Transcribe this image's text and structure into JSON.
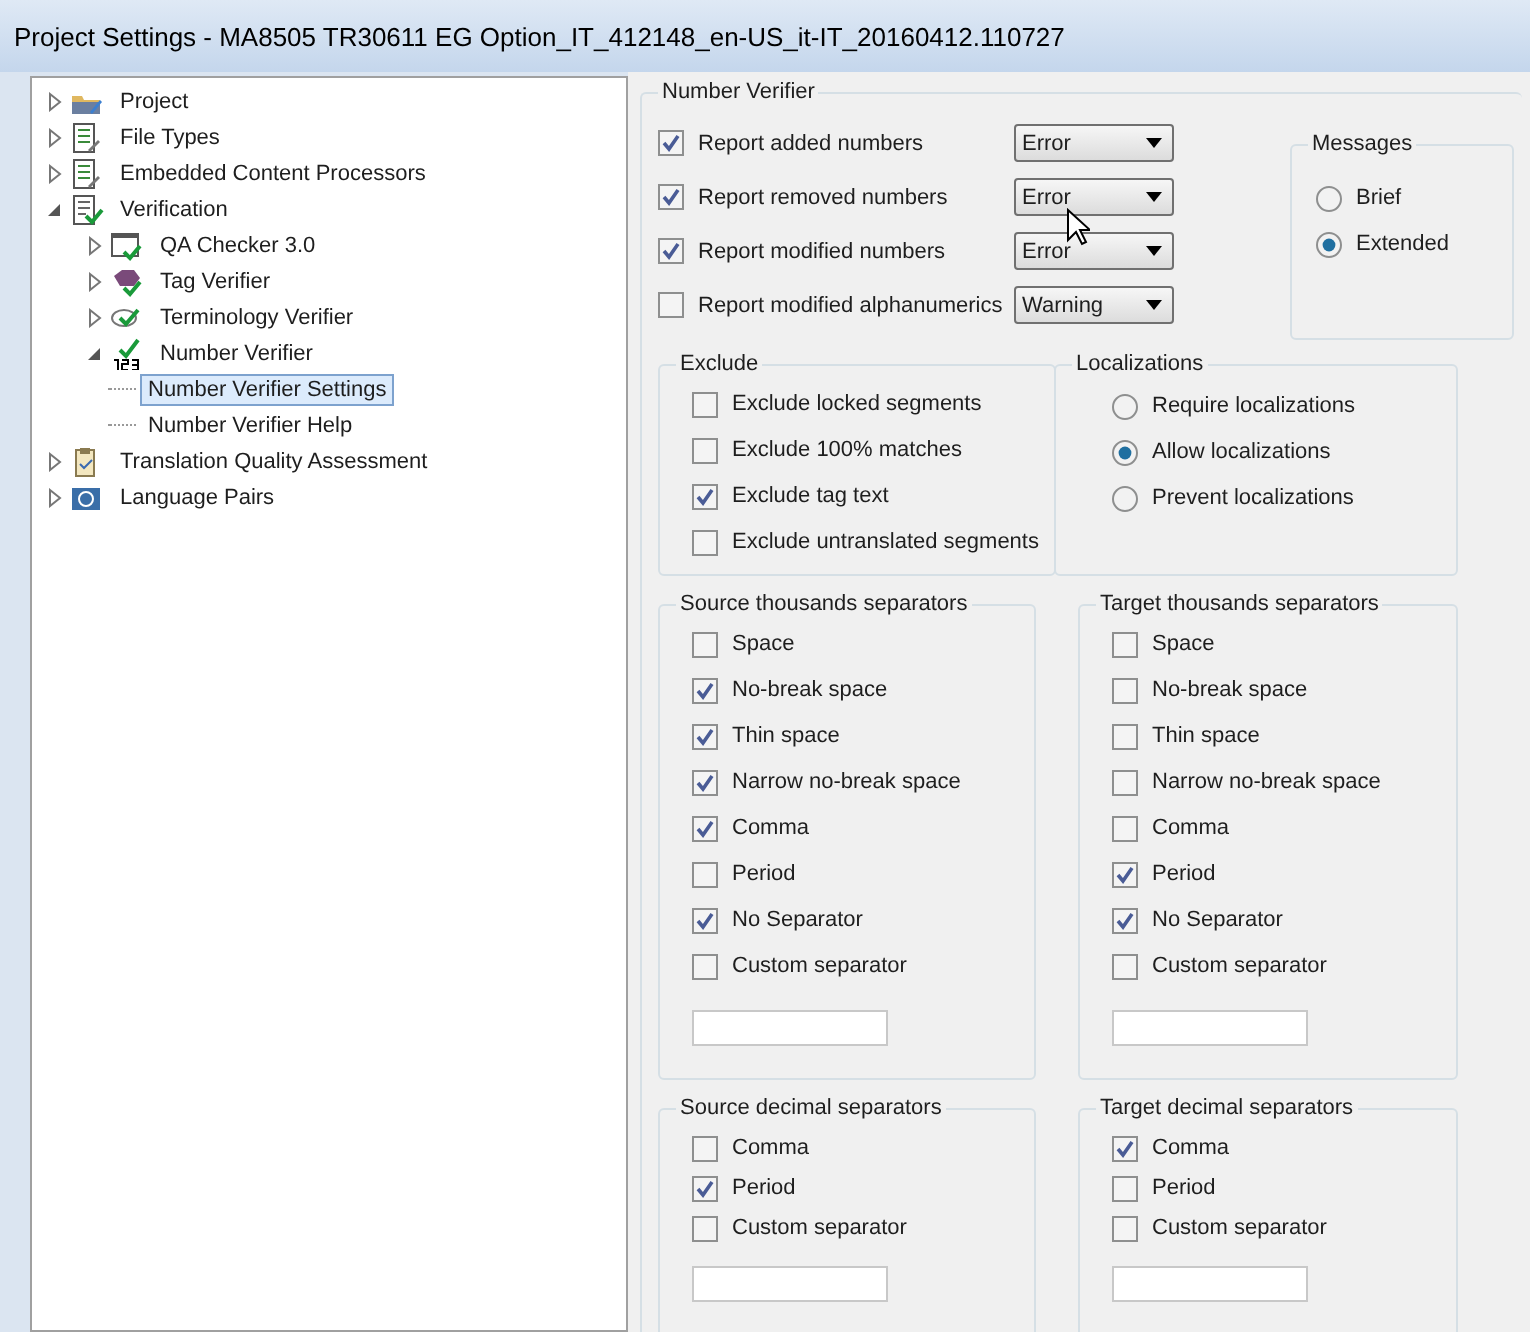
{
  "window": {
    "title": "Project Settings - MA8505 TR30611 EG Option_IT_412148_en-US_it-IT_20160412.110727"
  },
  "tree": [
    {
      "label": "Project",
      "kind": "folder",
      "expanded": false,
      "selected": false
    },
    {
      "label": "File Types",
      "kind": "document",
      "expanded": false,
      "selected": false
    },
    {
      "label": "Embedded Content Processors",
      "kind": "document",
      "expanded": false,
      "selected": false
    },
    {
      "label": "Verification",
      "kind": "checklist",
      "expanded": true,
      "selected": false,
      "children": [
        {
          "label": "QA Checker 3.0",
          "kind": "qa",
          "expanded": false,
          "selected": false
        },
        {
          "label": "Tag Verifier",
          "kind": "tag",
          "expanded": false,
          "selected": false
        },
        {
          "label": "Terminology Verifier",
          "kind": "terminology",
          "expanded": false,
          "selected": false
        },
        {
          "label": "Number Verifier",
          "kind": "number",
          "expanded": true,
          "selected": false,
          "children": [
            {
              "label": "Number Verifier Settings",
              "selected": true
            },
            {
              "label": "Number Verifier Help",
              "selected": false
            }
          ]
        }
      ]
    },
    {
      "label": "Translation Quality Assessment",
      "kind": "clipboard",
      "expanded": false,
      "selected": false
    },
    {
      "label": "Language Pairs",
      "kind": "language",
      "expanded": false,
      "selected": false
    }
  ],
  "number_verifier": {
    "title": "Number Verifier",
    "reports": [
      {
        "label": "Report added numbers",
        "checked": true,
        "severity": "Error"
      },
      {
        "label": "Report removed numbers",
        "checked": true,
        "severity": "Error"
      },
      {
        "label": "Report modified numbers",
        "checked": true,
        "severity": "Error"
      },
      {
        "label": "Report modified alphanumerics",
        "checked": false,
        "severity": "Warning"
      }
    ],
    "messages": {
      "title": "Messages",
      "options": [
        {
          "label": "Brief",
          "selected": false
        },
        {
          "label": "Extended",
          "selected": true
        }
      ]
    },
    "exclude": {
      "title": "Exclude",
      "items": [
        {
          "label": "Exclude locked segments",
          "checked": false
        },
        {
          "label": "Exclude 100% matches",
          "checked": false
        },
        {
          "label": "Exclude tag text",
          "checked": true
        },
        {
          "label": "Exclude untranslated segments",
          "checked": false
        }
      ]
    },
    "localizations": {
      "title": "Localizations",
      "options": [
        {
          "label": "Require localizations",
          "selected": false
        },
        {
          "label": "Allow localizations",
          "selected": true
        },
        {
          "label": "Prevent localizations",
          "selected": false
        }
      ]
    },
    "separator_groups": [
      {
        "title": "Source thousands separators",
        "custom_input": true,
        "items": [
          {
            "label": "Space",
            "checked": false
          },
          {
            "label": "No-break space",
            "checked": true
          },
          {
            "label": "Thin space",
            "checked": true
          },
          {
            "label": "Narrow no-break space",
            "checked": true
          },
          {
            "label": "Comma",
            "checked": true
          },
          {
            "label": "Period",
            "checked": false
          },
          {
            "label": "No Separator",
            "checked": true
          },
          {
            "label": "Custom separator",
            "checked": false
          }
        ]
      },
      {
        "title": "Target thousands separators",
        "custom_input": true,
        "items": [
          {
            "label": "Space",
            "checked": false
          },
          {
            "label": "No-break space",
            "checked": false
          },
          {
            "label": "Thin space",
            "checked": false
          },
          {
            "label": "Narrow no-break space",
            "checked": false
          },
          {
            "label": "Comma",
            "checked": false
          },
          {
            "label": "Period",
            "checked": true
          },
          {
            "label": "No Separator",
            "checked": true
          },
          {
            "label": "Custom separator",
            "checked": false
          }
        ]
      },
      {
        "title": "Source decimal separators",
        "custom_input": true,
        "items": [
          {
            "label": "Comma",
            "checked": false
          },
          {
            "label": "Period",
            "checked": true
          },
          {
            "label": "Custom separator",
            "checked": false
          }
        ]
      },
      {
        "title": "Target decimal separators",
        "custom_input": true,
        "items": [
          {
            "label": "Comma",
            "checked": true
          },
          {
            "label": "Period",
            "checked": false
          },
          {
            "label": "Custom separator",
            "checked": false
          }
        ]
      }
    ]
  }
}
